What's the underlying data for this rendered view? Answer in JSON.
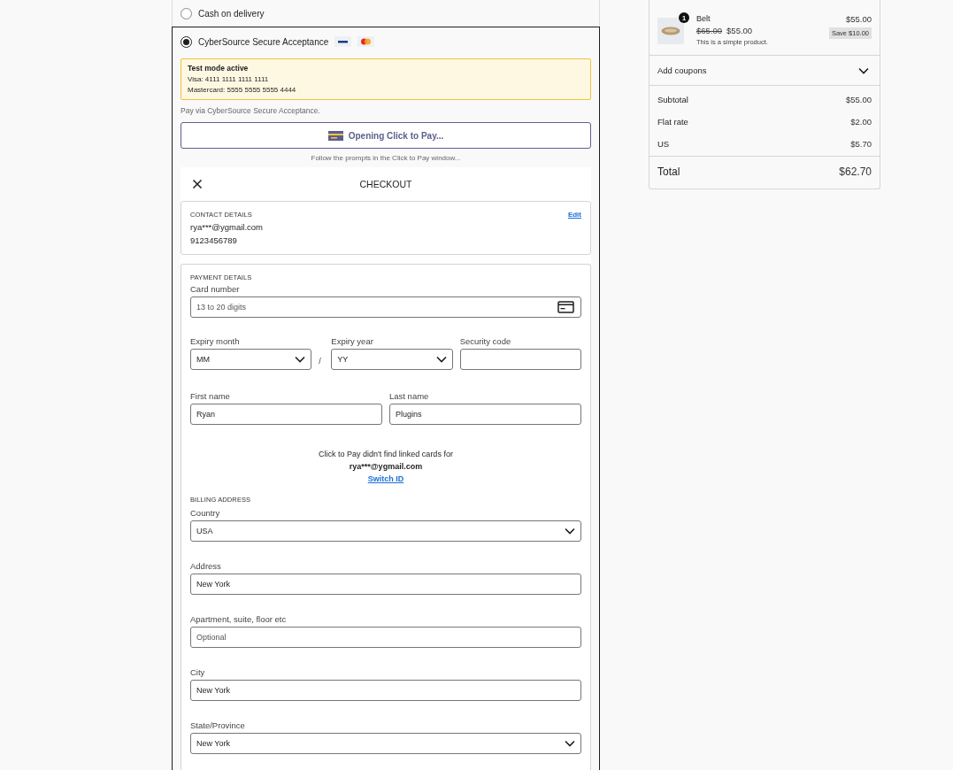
{
  "payment_methods": [
    {
      "label": "Cash on delivery",
      "selected": false
    },
    {
      "label": "CyberSource Secure Acceptance",
      "selected": true
    }
  ],
  "test_notice": {
    "title": "Test mode active",
    "lines": [
      "Visa: 4111 1111 1111 1111",
      "Mastercard: 5555 5555 5555 4444"
    ]
  },
  "description": "Pay via CyberSource Secure Acceptance.",
  "click_to_pay_button": {
    "label": "Opening Click to Pay..."
  },
  "prompt": "Follow the prompts in the Click to Pay window...",
  "checkout": {
    "title": "CHECKOUT",
    "contact": {
      "heading": "CONTACT DETAILS",
      "edit": "Edit",
      "lines": [
        "rya***@ygmail.com",
        "9123456789"
      ]
    },
    "payment": {
      "heading": "PAYMENT DETAILS",
      "card_number": {
        "label": "Card number",
        "kind": "input",
        "placeholder": "13 to 20 digits"
      },
      "expiry_month": {
        "label": "Expiry month",
        "kind": "select",
        "value": "MM"
      },
      "separator": "/",
      "expiry_year": {
        "label": "Expiry year",
        "kind": "select",
        "value": "YY"
      },
      "security_code": {
        "label": "Security code",
        "kind": "input"
      },
      "first_name": {
        "label": "First name",
        "kind": "input",
        "value": "Ryan"
      },
      "last_name": {
        "label": "Last name",
        "kind": "input",
        "value": "Plugins"
      }
    },
    "no_cards_notice": {
      "text": "Click to Pay didn't find linked cards for",
      "email": "rya***@ygmail.com",
      "link": "Switch ID"
    },
    "billing": {
      "heading": "BILLING ADDRESS",
      "fields": [
        {
          "label": "Country",
          "kind": "select",
          "value": "USA"
        },
        {
          "label": "Address",
          "kind": "input",
          "value": "New York"
        },
        {
          "label": "Apartment, suite, floor etc",
          "kind": "input",
          "placeholder": "Optional"
        },
        {
          "label": "City",
          "kind": "input",
          "value": "New York"
        },
        {
          "label": "State/Province",
          "kind": "select",
          "value": "New York"
        }
      ]
    }
  },
  "order_summary": {
    "items": [
      {
        "name": "Belt",
        "quantity": "1",
        "old_price": "$65.00",
        "price": "$55.00",
        "line_total": "$55.00",
        "save": "Save $10.00",
        "description": "This is a simple product."
      }
    ],
    "coupons": {
      "label": "Add coupons",
      "expanded": false
    },
    "lines": [
      {
        "label": "Subtotal",
        "value": "$55.00"
      },
      {
        "label": "Flat rate",
        "value": "$2.00"
      },
      {
        "label": "US",
        "value": "$5.70"
      }
    ],
    "total": {
      "label": "Total",
      "value": "$62.70"
    }
  }
}
